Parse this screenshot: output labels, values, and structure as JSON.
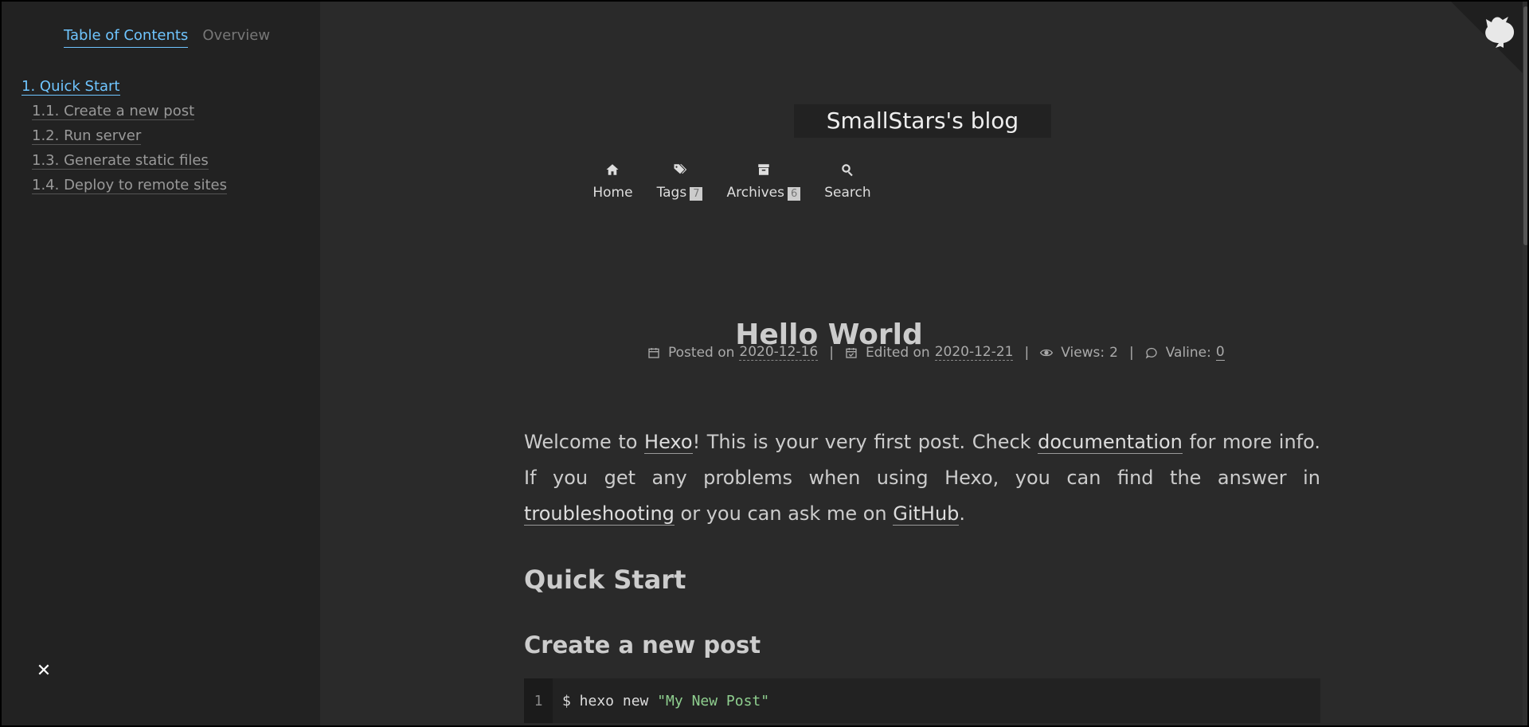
{
  "sidebar": {
    "tabs": [
      {
        "label": "Table of Contents",
        "active": true
      },
      {
        "label": "Overview",
        "active": false
      }
    ],
    "toc": [
      {
        "label": "1. Quick Start",
        "level": 1
      },
      {
        "label": "1.1. Create a new post",
        "level": 2
      },
      {
        "label": "1.2. Run server",
        "level": 2
      },
      {
        "label": "1.3. Generate static files",
        "level": 2
      },
      {
        "label": "1.4. Deploy to remote sites",
        "level": 2
      }
    ],
    "close_symbol": "✕"
  },
  "header": {
    "brand": "SmallStars's blog",
    "nav": [
      {
        "label": "Home",
        "icon": "home-icon"
      },
      {
        "label": "Tags",
        "icon": "tags-icon",
        "badge": "7"
      },
      {
        "label": "Archives",
        "icon": "archive-icon",
        "badge": "6"
      },
      {
        "label": "Search",
        "icon": "search-icon"
      }
    ]
  },
  "post": {
    "title": "Hello World",
    "meta": {
      "posted_label": "Posted on",
      "posted_date": "2020-12-16",
      "edited_label": "Edited on",
      "edited_date": "2020-12-21",
      "views_label": "Views:",
      "views": "2",
      "valine_label": "Valine:",
      "valine_count": "0",
      "separator": "|"
    },
    "intro": {
      "t1": "Welcome to ",
      "hexo": "Hexo",
      "t2": "! This is your very first post. Check ",
      "documentation": "documentation",
      "t3": " for more info. If you get any problems when using Hexo, you can find the answer in ",
      "troubleshooting": "troubleshooting",
      "t4": " or you can ask me on ",
      "github": "GitHub",
      "t5": "."
    },
    "h2": "Quick Start",
    "h3": "Create a new post",
    "code": {
      "line_number": "1",
      "command": "$ hexo new ",
      "string": "\"My New Post\""
    }
  },
  "colors": {
    "accent": "#6fc5ff",
    "background": "#2a2a2a",
    "sidebar": "#222222"
  }
}
